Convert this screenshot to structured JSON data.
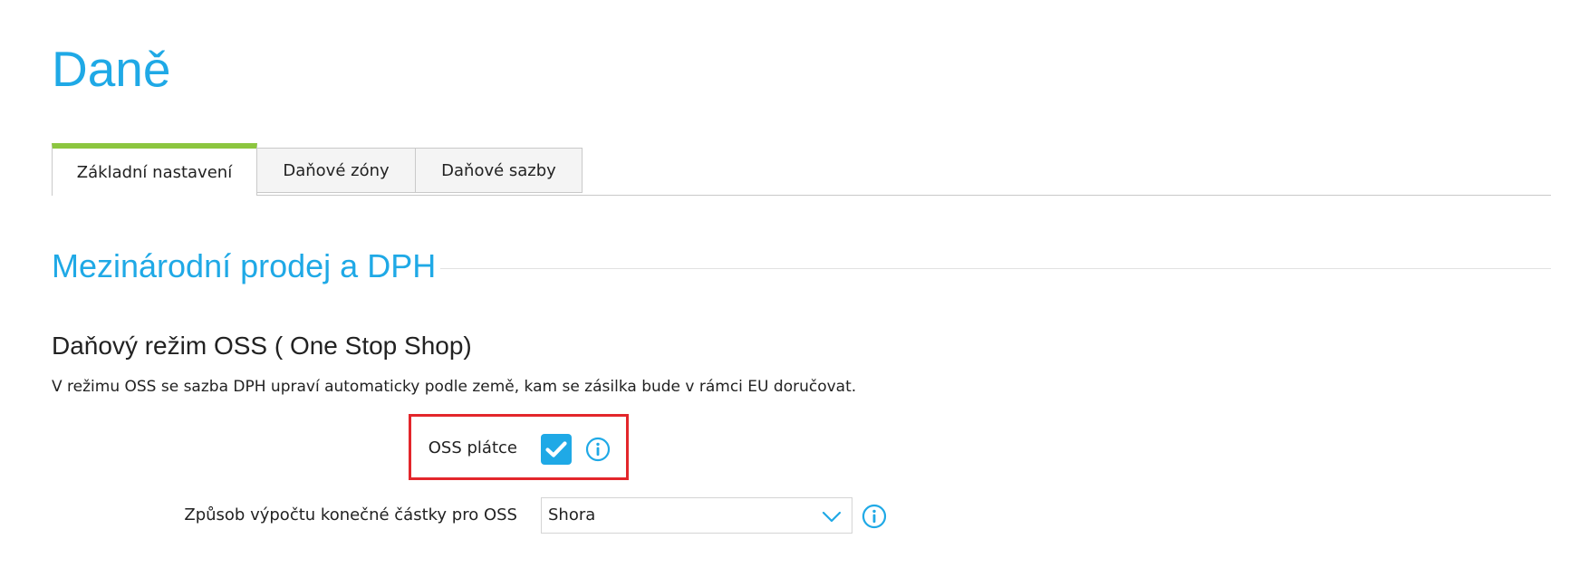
{
  "page": {
    "title": "Daně"
  },
  "tabs": [
    {
      "label": "Základní nastavení",
      "active": true
    },
    {
      "label": "Daňové zóny",
      "active": false
    },
    {
      "label": "Daňové sazby",
      "active": false
    }
  ],
  "section": {
    "heading": "Mezinárodní prodej a DPH",
    "subheading": "Daňový režim OSS ( One Stop Shop)",
    "description": "V režimu OSS se sazba DPH upraví automaticky podle země, kam se zásilka bude v rámci EU doručovat."
  },
  "fields": {
    "oss_payer": {
      "label": "OSS plátce",
      "checked": true,
      "icon": "info-icon"
    },
    "calc_method": {
      "label": "Způsob výpočtu konečné částky pro OSS",
      "value": "Shora",
      "icon": "chevron-down-icon"
    }
  },
  "colors": {
    "accent": "#1fa9e6",
    "active_tab_bar": "#8cc63f",
    "highlight_border": "#e3262b"
  }
}
